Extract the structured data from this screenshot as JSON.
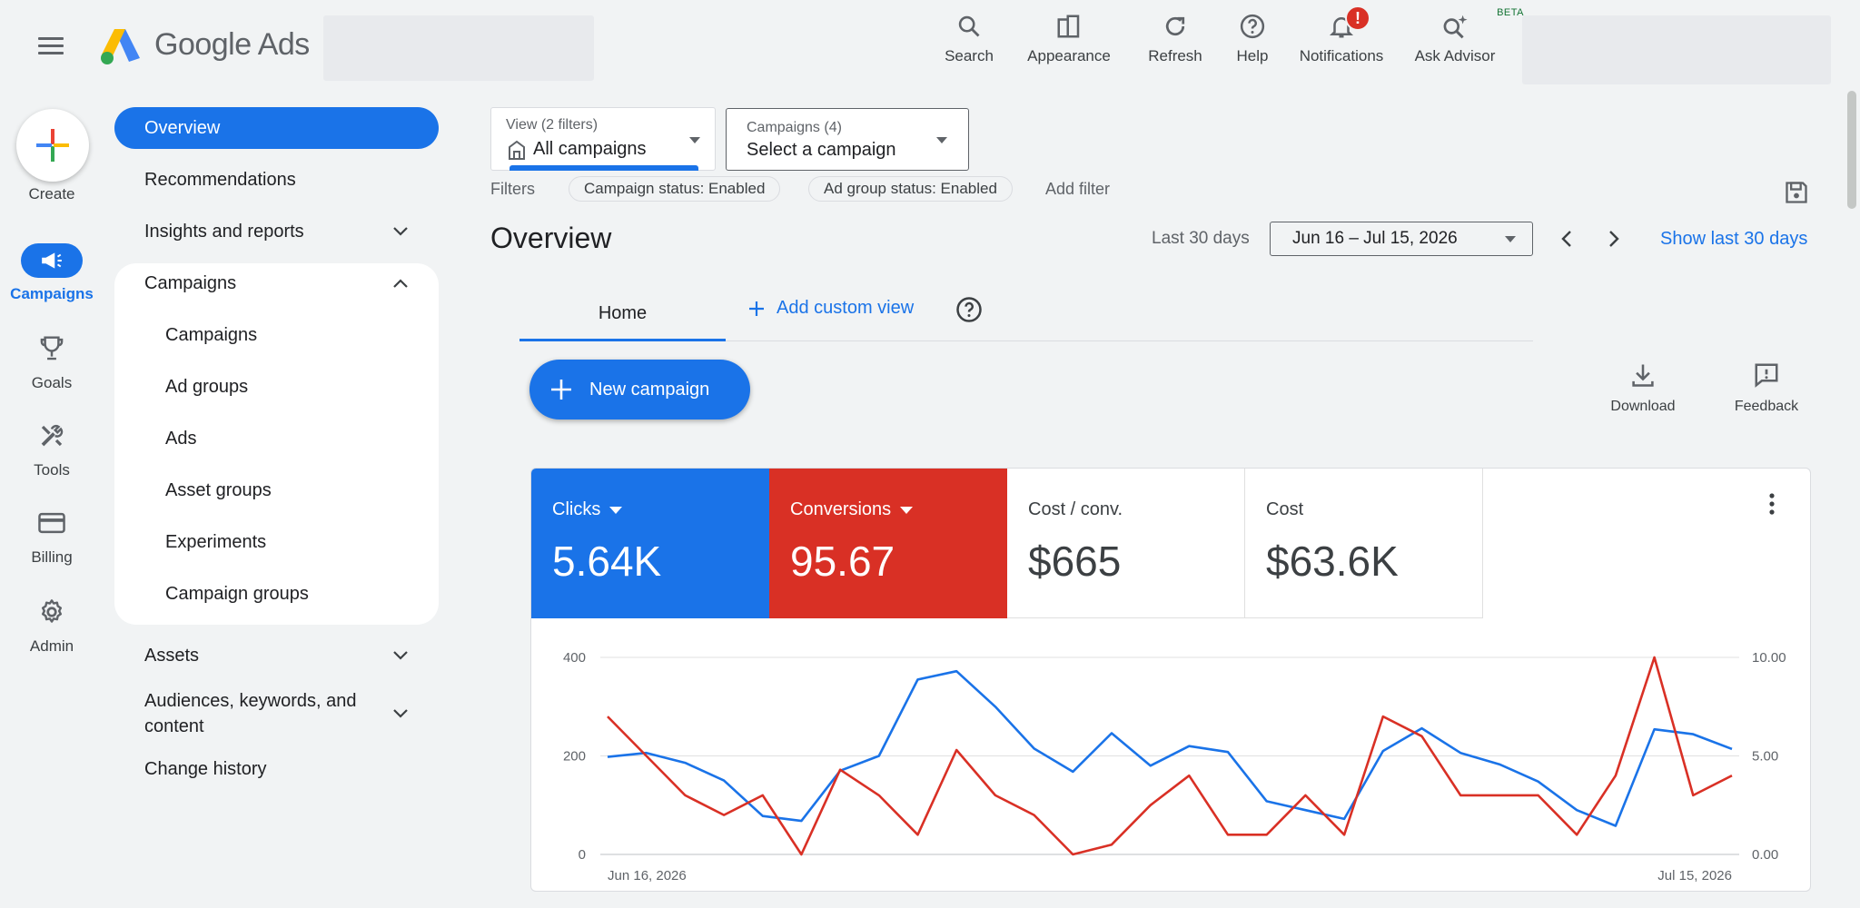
{
  "brand": {
    "name": "Google Ads"
  },
  "topbar": {
    "buttons": [
      {
        "label": "Search",
        "icon": "search-icon"
      },
      {
        "label": "Appearance",
        "icon": "appearance-icon"
      },
      {
        "label": "Refresh",
        "icon": "refresh-icon"
      },
      {
        "label": "Help",
        "icon": "help-icon"
      },
      {
        "label": "Notifications",
        "icon": "bell-icon",
        "badge": "!"
      },
      {
        "label": "Ask Advisor",
        "icon": "advisor-icon",
        "tag": "BETA"
      }
    ]
  },
  "rail": {
    "create": "Create",
    "items": [
      {
        "label": "Campaigns",
        "icon": "megaphone-icon",
        "active": true
      },
      {
        "label": "Goals",
        "icon": "trophy-icon"
      },
      {
        "label": "Tools",
        "icon": "tools-icon"
      },
      {
        "label": "Billing",
        "icon": "credit-card-icon"
      },
      {
        "label": "Admin",
        "icon": "gear-icon"
      }
    ]
  },
  "nav": {
    "overview": "Overview",
    "recommendations": "Recommendations",
    "insights": "Insights and reports",
    "campaigns": "Campaigns",
    "sub": [
      "Campaigns",
      "Ad groups",
      "Ads",
      "Asset groups",
      "Experiments",
      "Campaign groups"
    ],
    "assets": "Assets",
    "audiences_line1": "Audiences, keywords, and",
    "audiences_line2": "content",
    "change_history": "Change history"
  },
  "filters": {
    "view_small": "View (2 filters)",
    "view_value": "All campaigns",
    "campaigns_small": "Campaigns (4)",
    "campaigns_value": "Select a campaign",
    "label": "Filters",
    "chips": [
      "Campaign status: Enabled",
      "Ad group status: Enabled"
    ],
    "add": "Add filter"
  },
  "overview": {
    "title": "Overview",
    "range_label": "Last 30 days",
    "date_range": "Jun 16 – Jul 15, 2026",
    "show_last": "Show last 30 days"
  },
  "tabs": {
    "home": "Home",
    "add_view": "Add custom view"
  },
  "actions": {
    "new_campaign": "New campaign",
    "download": "Download",
    "feedback": "Feedback"
  },
  "metrics": [
    {
      "label": "Clicks",
      "value": "5.64K",
      "color": "#1a73e8"
    },
    {
      "label": "Conversions",
      "value": "95.67",
      "color": "#d93025"
    },
    {
      "label": "Cost / conv.",
      "value": "$665"
    },
    {
      "label": "Cost",
      "value": "$63.6K"
    }
  ],
  "chart_data": {
    "type": "line",
    "x_start_label": "Jun 16, 2026",
    "x_end_label": "Jul 15, 2026",
    "y_left_ticks": [
      "0",
      "200",
      "400"
    ],
    "y_right_ticks": [
      "0.00",
      "5.00",
      "10.00"
    ],
    "ylim_left": [
      0,
      400
    ],
    "ylim_right": [
      0,
      10
    ],
    "grid": true,
    "series": [
      {
        "name": "Clicks",
        "axis": "left",
        "color": "#1a73e8",
        "values": [
          198,
          206,
          186,
          150,
          78,
          68,
          170,
          200,
          355,
          372,
          300,
          215,
          168,
          246,
          180,
          220,
          208,
          108,
          90,
          72,
          210,
          256,
          206,
          183,
          148,
          90,
          58,
          254,
          244,
          214
        ]
      },
      {
        "name": "Conversions",
        "axis": "right",
        "color": "#d93025",
        "values": [
          7.0,
          5.0,
          3.0,
          2.0,
          3.0,
          0.0,
          4.3,
          3.0,
          1.0,
          5.3,
          3.0,
          2.0,
          0.0,
          0.5,
          2.5,
          4.0,
          1.0,
          1.0,
          3.0,
          1.0,
          7.0,
          6.0,
          3.0,
          3.0,
          3.0,
          1.0,
          4.0,
          10.0,
          3.0,
          4.0
        ]
      }
    ]
  }
}
